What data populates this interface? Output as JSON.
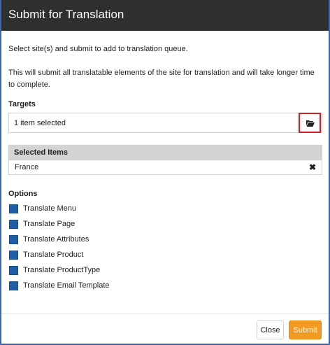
{
  "dialog": {
    "title": "Submit for Translation",
    "intro_line1": "Select site(s) and submit to add to translation queue.",
    "intro_line2": "This will submit all translatable elements of the site for translation and will take longer time to complete."
  },
  "targets": {
    "label": "Targets",
    "value": "1 item selected",
    "browse_icon": "folder-open-icon"
  },
  "selected_items": {
    "header": "Selected Items",
    "rows": [
      {
        "label": "France",
        "remove_icon": "close-icon"
      }
    ]
  },
  "options": {
    "label": "Options",
    "items": [
      {
        "label": "Translate Menu",
        "checked": true
      },
      {
        "label": "Translate Page",
        "checked": true
      },
      {
        "label": "Translate Attributes",
        "checked": true
      },
      {
        "label": "Translate Product",
        "checked": true
      },
      {
        "label": "Translate ProductType",
        "checked": true
      },
      {
        "label": "Translate Email Template",
        "checked": true
      }
    ]
  },
  "footer": {
    "close_label": "Close",
    "submit_label": "Submit"
  },
  "colors": {
    "header_bg": "#2f2f2f",
    "checkbox": "#1f5fa8",
    "submit": "#f39a22",
    "highlight_border": "#d0202a"
  }
}
